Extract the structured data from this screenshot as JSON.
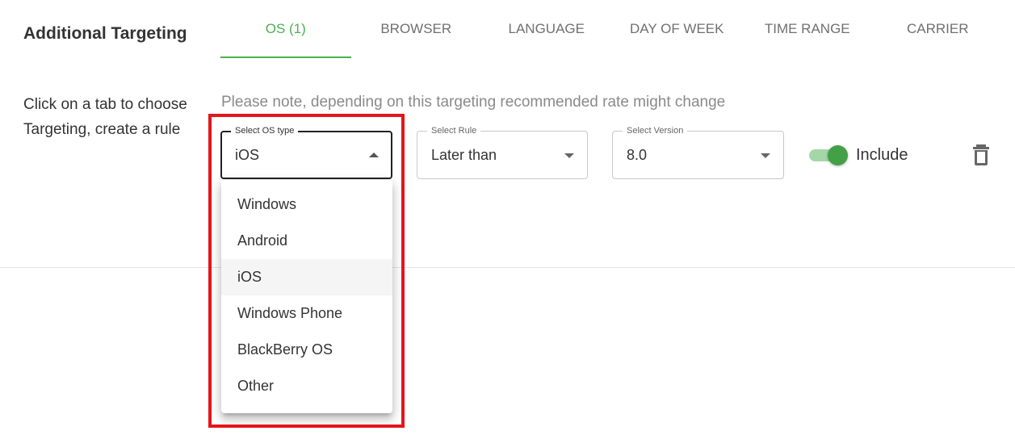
{
  "header": {
    "title": "Additional Targeting",
    "tabs": [
      {
        "label": "OS (1)",
        "active": true
      },
      {
        "label": "BROWSER"
      },
      {
        "label": "LANGUAGE"
      },
      {
        "label": "DAY OF WEEK"
      },
      {
        "label": "TIME RANGE"
      },
      {
        "label": "CARRIER"
      }
    ]
  },
  "hint": {
    "line1": "Click on a tab to choose",
    "line2": "Targeting, create a rule"
  },
  "note": "Please note, depending on this targeting recommended rate might change",
  "rule": {
    "os_type": {
      "label": "Select OS type",
      "value": "iOS"
    },
    "rule_select": {
      "label": "Select Rule",
      "value": "Later than"
    },
    "version": {
      "label": "Select Version",
      "value": "8.0"
    },
    "include": {
      "label": "Include",
      "checked": true
    }
  },
  "os_menu": {
    "items": [
      "Windows",
      "Android",
      "iOS",
      "Windows Phone",
      "BlackBerry OS",
      "Other"
    ],
    "selected": "iOS"
  },
  "colors": {
    "accent": "#4caf50",
    "highlight": "#e3161b",
    "toggle_track": "#a5d6a7",
    "toggle_knob": "#43a047"
  },
  "icons": {
    "delete": "trash-icon",
    "dropdown": "caret-icon"
  }
}
